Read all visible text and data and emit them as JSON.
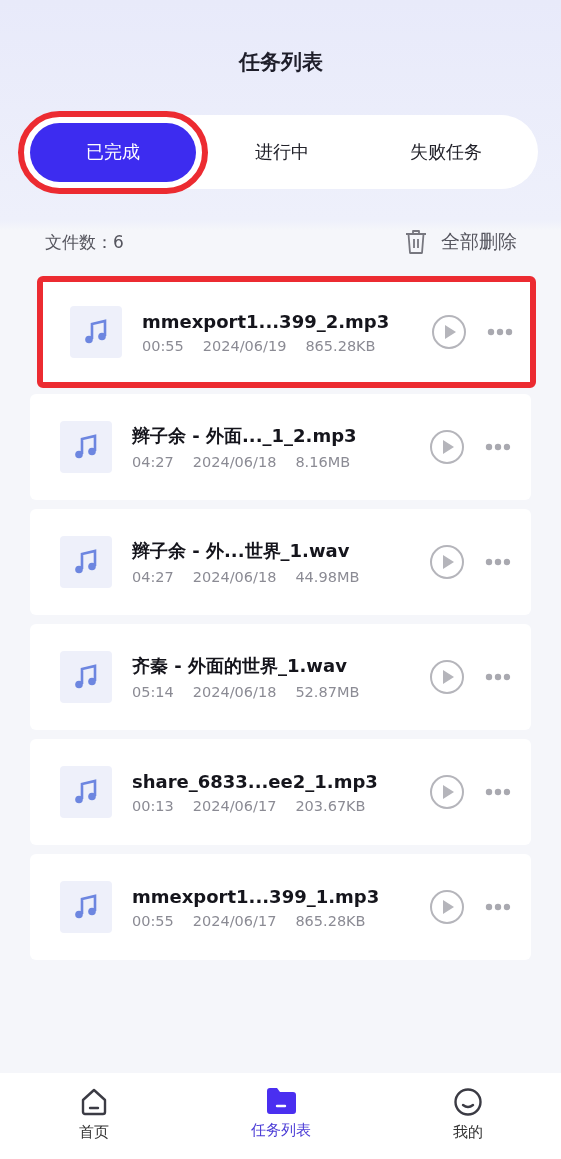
{
  "title": "任务列表",
  "tabs": [
    {
      "label": "已完成",
      "selected": true,
      "highlighted": true
    },
    {
      "label": "进行中",
      "selected": false,
      "highlighted": false
    },
    {
      "label": "失败任务",
      "selected": false,
      "highlighted": false
    }
  ],
  "file_count": "文件数：6",
  "delete_all": "全部删除",
  "files": [
    {
      "name": "mmexport1...399_2.mp3",
      "duration": "00:55",
      "date": "2024/06/19",
      "size": "865.28KB",
      "highlighted": true
    },
    {
      "name": "辫子余 - 外面..._1_2.mp3",
      "duration": "04:27",
      "date": "2024/06/18",
      "size": "8.16MB",
      "highlighted": false
    },
    {
      "name": "辫子余 - 外...世界_1.wav",
      "duration": "04:27",
      "date": "2024/06/18",
      "size": "44.98MB",
      "highlighted": false
    },
    {
      "name": "齐秦 - 外面的世界_1.wav",
      "duration": "05:14",
      "date": "2024/06/18",
      "size": "52.87MB",
      "highlighted": false
    },
    {
      "name": "share_6833...ee2_1.mp3",
      "duration": "00:13",
      "date": "2024/06/17",
      "size": "203.67KB",
      "highlighted": false
    },
    {
      "name": "mmexport1...399_1.mp3",
      "duration": "00:55",
      "date": "2024/06/17",
      "size": "865.28KB",
      "highlighted": false
    }
  ],
  "nav": [
    {
      "kind": "home",
      "label": "首页",
      "selected": false
    },
    {
      "kind": "tasks",
      "label": "任务列表",
      "selected": true
    },
    {
      "kind": "me",
      "label": "我的",
      "selected": false
    }
  ]
}
